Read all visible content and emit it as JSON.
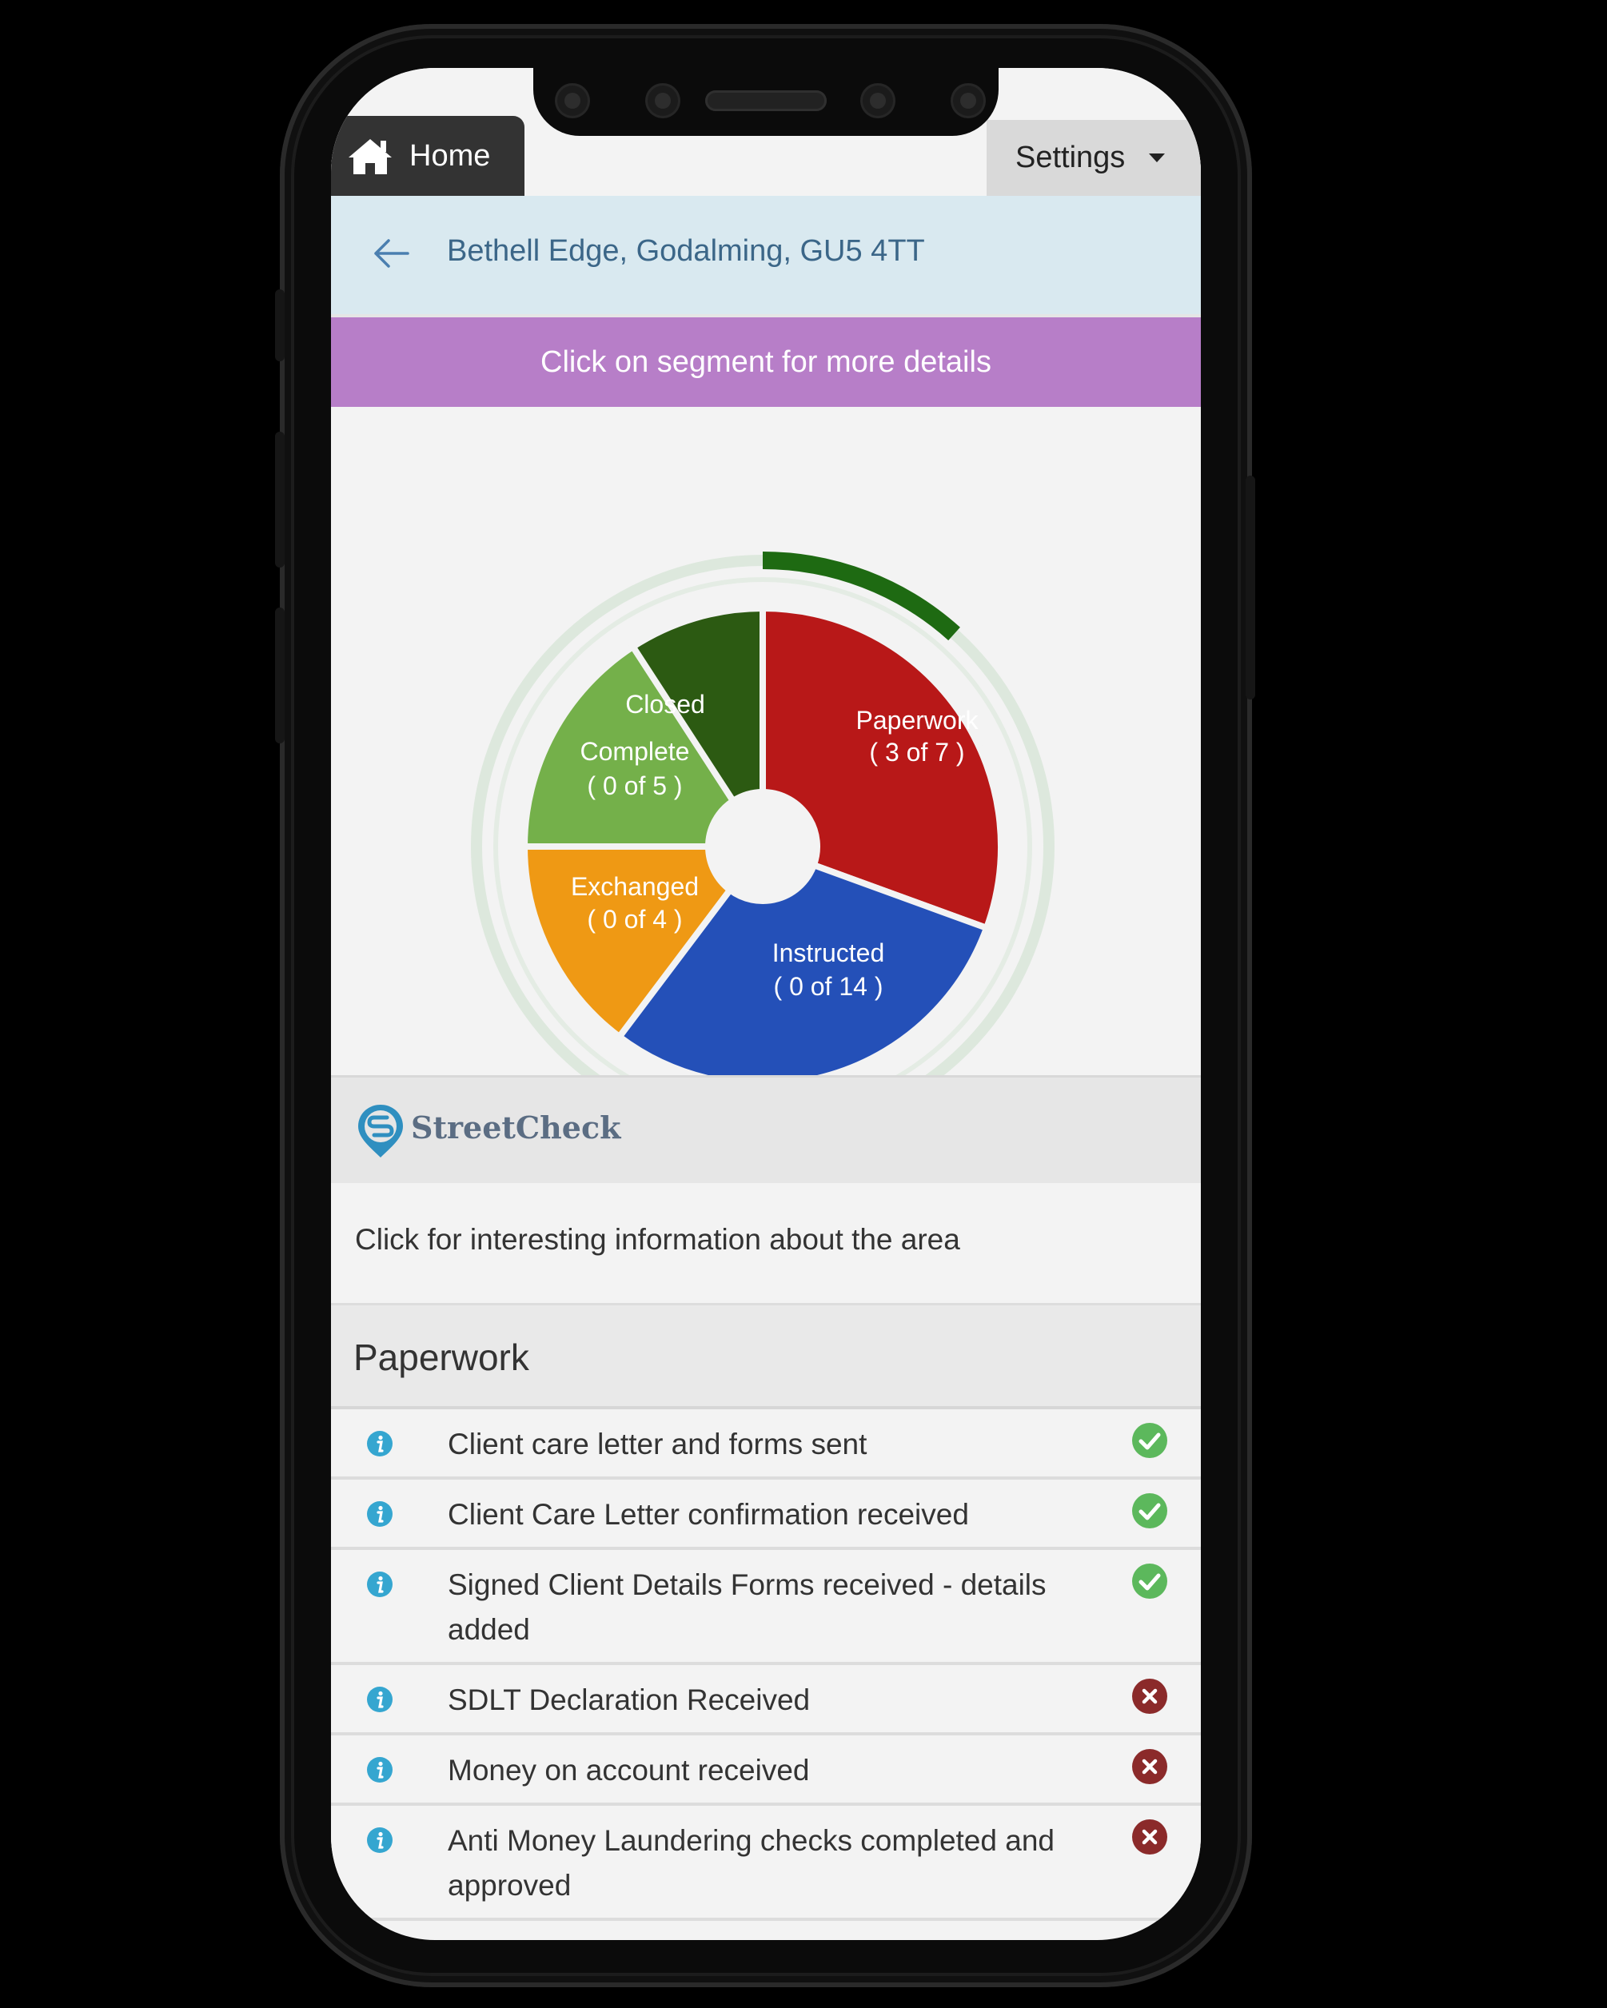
{
  "nav": {
    "home_label": "Home",
    "settings_label": "Settings"
  },
  "address": "Bethell Edge, Godalming, GU5 4TT",
  "banner": "Click on segment for more details",
  "chart_data": {
    "type": "pie",
    "segments": [
      {
        "name": "Paperwork",
        "count": "( 3 of 7 )",
        "color": "#b81818"
      },
      {
        "name": "Instructed",
        "count": "( 0 of 14 )",
        "color": "#2450b8"
      },
      {
        "name": "Exchanged",
        "count": "( 0 of 4 )",
        "color": "#ef9914"
      },
      {
        "name": "Complete",
        "count": "( 0 of 5 )",
        "color": "#74b04a"
      },
      {
        "name": "Closed",
        "count": "",
        "color": "#2c5a12"
      }
    ],
    "progress_color": "#1e6a12"
  },
  "streetcheck": {
    "brand": "StreetCheck",
    "link_text": "Click for interesting information about the area"
  },
  "section_title": "Paperwork",
  "tasks": [
    {
      "text": "Client care letter and forms sent",
      "status": "complete"
    },
    {
      "text": "Client Care Letter confirmation received",
      "status": "complete"
    },
    {
      "text": "Signed Client Details Forms received - details added",
      "status": "complete"
    },
    {
      "text": "SDLT Declaration Received",
      "status": "incomplete"
    },
    {
      "text": "Money on account received",
      "status": "incomplete"
    },
    {
      "text": "Anti Money Laundering checks completed and approved",
      "status": "incomplete"
    }
  ],
  "colors": {
    "complete": "#5cb85c",
    "incomplete": "#8b2a2a",
    "info": "#35a6d0",
    "banner": "#b77ec8"
  }
}
